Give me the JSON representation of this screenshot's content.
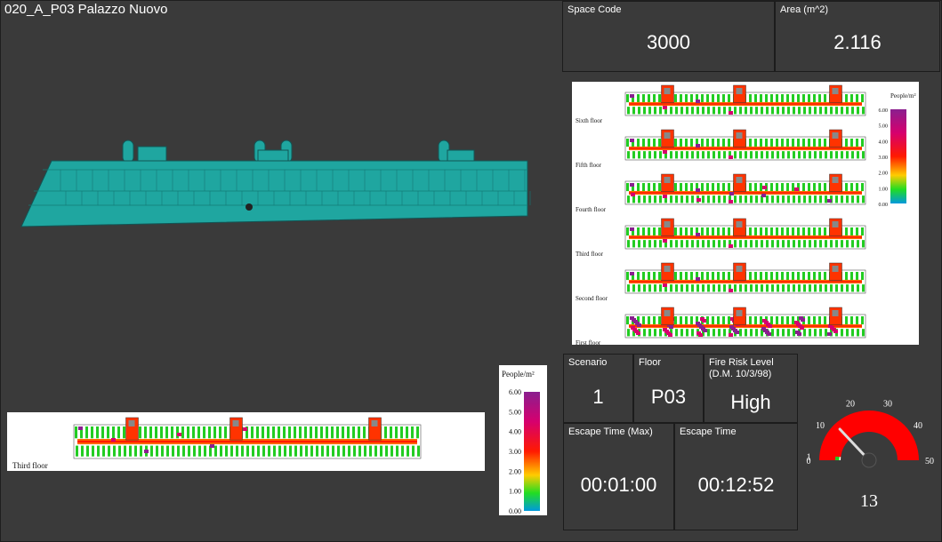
{
  "header": {
    "title": "020_A_P03 Palazzo Nuovo"
  },
  "cards": {
    "space_code": {
      "label": "Space Code",
      "value": "3000"
    },
    "area": {
      "label": "Area (m^2)",
      "value": "2.116"
    },
    "scenario": {
      "label": "Scenario",
      "value": "1"
    },
    "floor": {
      "label": "Floor",
      "value": "P03"
    },
    "fire_risk": {
      "label": "Fire Risk Level",
      "sub": "(D.M. 10/3/98)",
      "value": "High"
    },
    "escape_max": {
      "label": "Escape Time (Max)",
      "value": "00:01:00"
    },
    "escape": {
      "label": "Escape Time",
      "value": "00:12:52"
    }
  },
  "density_map": {
    "floors": [
      "Sixth floor",
      "Fifth floor",
      "Fourth floor",
      "Third floor",
      "Second floor",
      "First floor"
    ],
    "legend_title": "People/m²",
    "legend_ticks": [
      "6.00",
      "5.00",
      "4.00",
      "3.00",
      "2.00",
      "1.00",
      "0.00"
    ]
  },
  "third_floor_map": {
    "label": "Third floor",
    "legend_title": "People/m²",
    "legend_ticks": [
      "6.00",
      "5.00",
      "4.00",
      "3.00",
      "2.00",
      "1.00",
      "0.00"
    ]
  },
  "gauge": {
    "value": 13,
    "display": "13",
    "min": 0,
    "max": 50,
    "ticks": [
      "0",
      "1",
      "10",
      "20",
      "30",
      "40",
      "50"
    ],
    "colors": {
      "main": "#ff0000",
      "low": "#22cc22",
      "needle": "#dddddd"
    }
  }
}
